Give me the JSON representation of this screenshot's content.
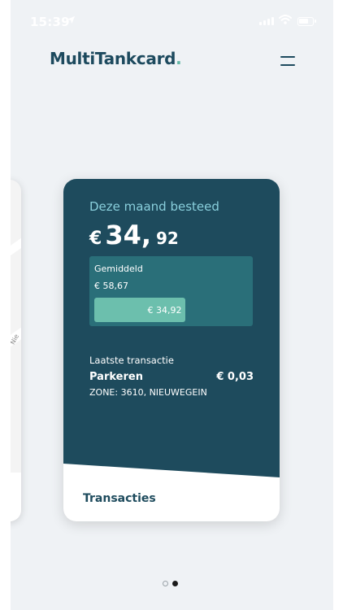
{
  "status_bar": {
    "time": "15:39"
  },
  "header": {
    "logo_main": "MultiTankcard",
    "logo_accent": "."
  },
  "peek_card": {
    "street_fragment": "Nie"
  },
  "card": {
    "spent_label": "Deze maand besteed",
    "amount": {
      "currency": "€",
      "whole": "34",
      "separator": ",",
      "cents": "92"
    },
    "average": {
      "label": "Gemiddeld",
      "value": "€ 58,67",
      "current_label": "€ 34,92",
      "current_fraction": 0.595
    },
    "last_transaction": {
      "label": "Laatste transactie",
      "name": "Parkeren",
      "amount": "€ 0,03",
      "detail": "ZONE: 3610, NIEUWEGEIN"
    },
    "transactions_link": "Transacties"
  },
  "pager": {
    "count": 2,
    "active": 1
  },
  "colors": {
    "primary": "#1e4b5d",
    "accent": "#63b7a5",
    "bar": "#6cbfad",
    "avg_box": "#2a6f79",
    "label": "#89cfdc"
  }
}
